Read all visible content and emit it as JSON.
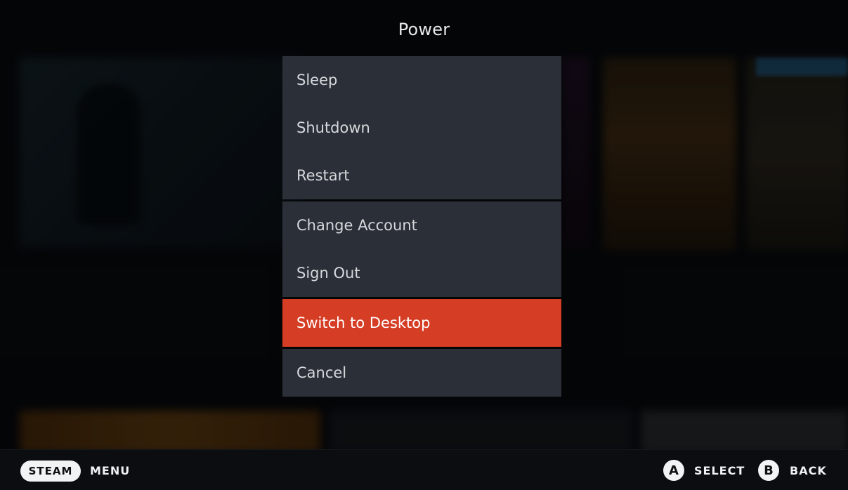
{
  "header": {
    "title": "Power"
  },
  "menu": {
    "groups": [
      {
        "items": [
          {
            "label": "Sleep"
          },
          {
            "label": "Shutdown"
          },
          {
            "label": "Restart"
          }
        ]
      },
      {
        "items": [
          {
            "label": "Change Account"
          },
          {
            "label": "Sign Out"
          }
        ]
      },
      {
        "items": [
          {
            "label": "Switch to Desktop",
            "selected": true
          }
        ]
      },
      {
        "items": [
          {
            "label": "Cancel"
          }
        ]
      }
    ]
  },
  "footer": {
    "steam_button": "STEAM",
    "steam_action": "MENU",
    "a_button": "A",
    "a_action": "SELECT",
    "b_button": "B",
    "b_action": "BACK"
  },
  "colors": {
    "accent": "#d63d25",
    "menu_bg": "#2b2f38",
    "footer_bg": "#0b0d10"
  }
}
